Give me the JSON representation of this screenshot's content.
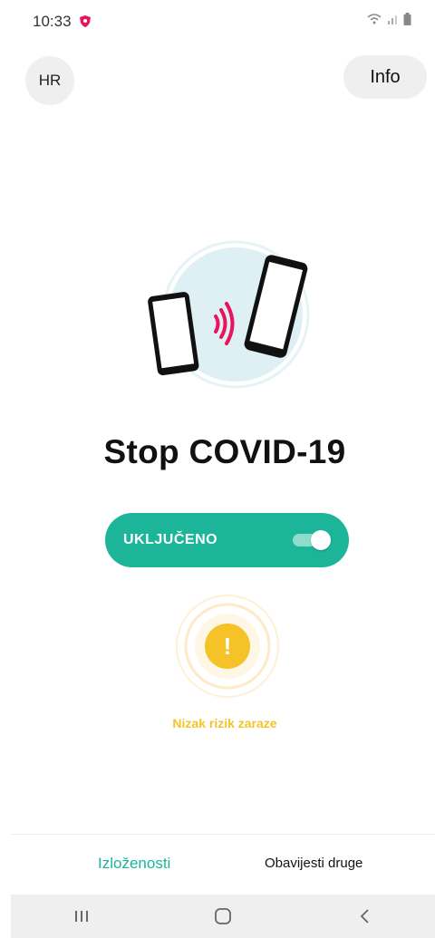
{
  "status_bar": {
    "time": "10:33"
  },
  "header": {
    "language_label": "HR",
    "info_label": "Info"
  },
  "main": {
    "title": "Stop COVID-19",
    "toggle": {
      "label": "UKLJUČENO",
      "state": "on"
    },
    "risk": {
      "symbol": "!",
      "label": "Nizak rizik zaraze"
    }
  },
  "bottom_tabs": [
    {
      "label": "Izloženosti",
      "active": true
    },
    {
      "label": "Obavijesti druge",
      "active": false
    }
  ],
  "colors": {
    "accent": "#1cb59a",
    "warning": "#f5c328",
    "signal": "#e8145f"
  },
  "icons": [
    "app-shield-icon",
    "wifi-icon",
    "signal-icon",
    "battery-icon",
    "phones-illustration",
    "exclamation-icon",
    "recents-icon",
    "home-icon",
    "back-icon"
  ]
}
